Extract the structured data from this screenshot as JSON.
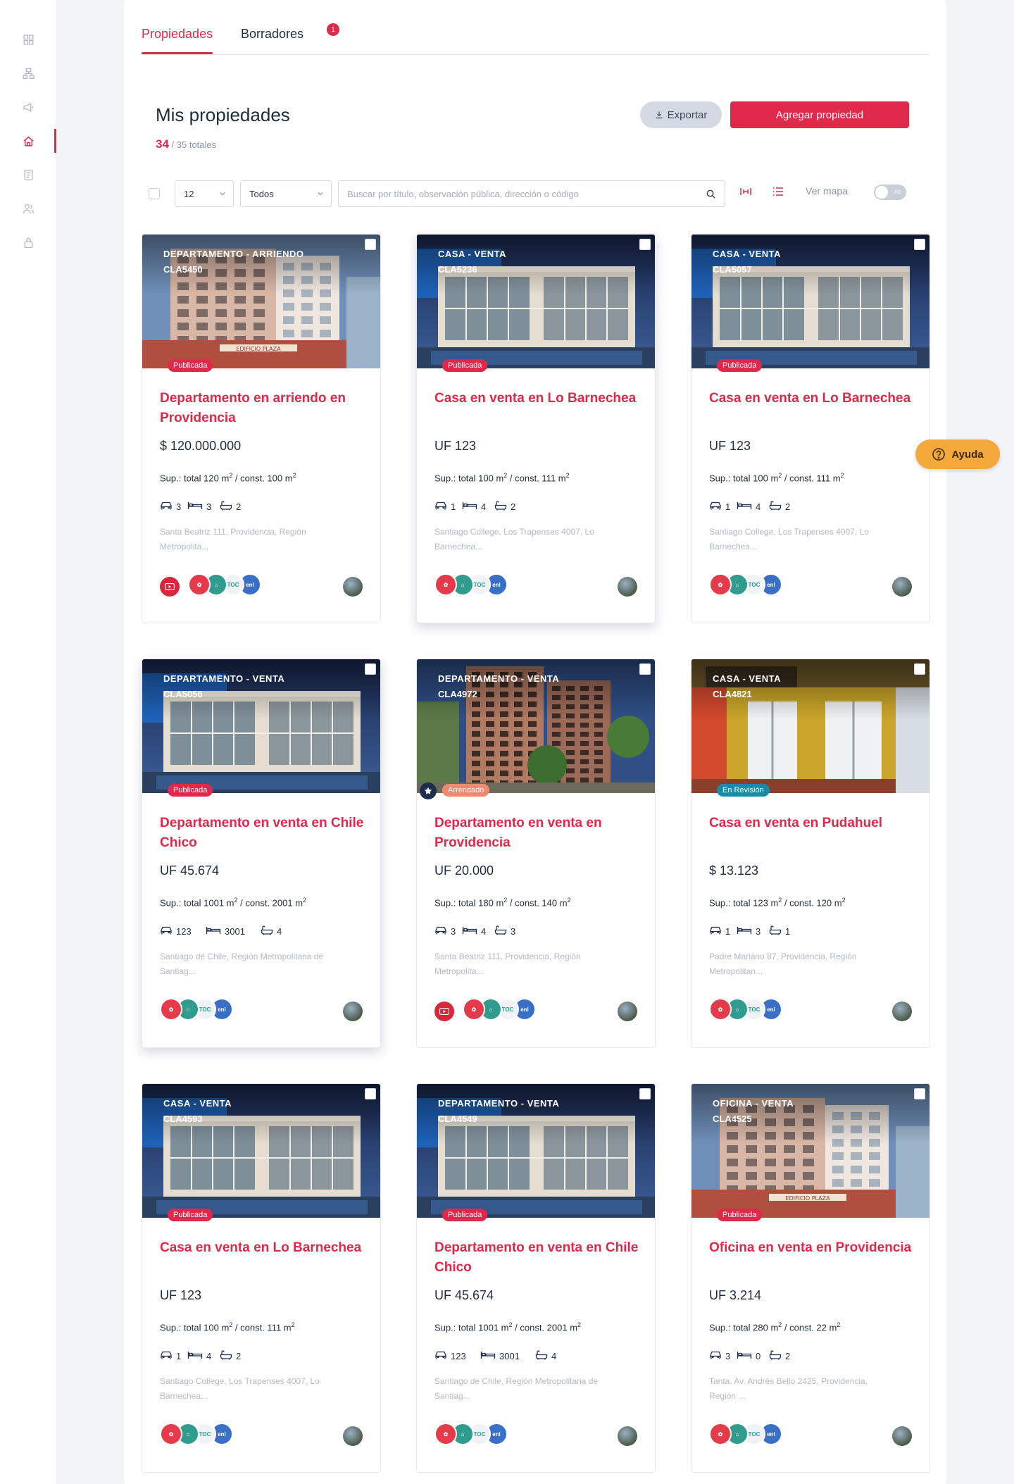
{
  "tabs": [
    {
      "label": "Propiedades",
      "active": true
    },
    {
      "label": "Borradores",
      "badge": "1"
    }
  ],
  "header": {
    "title": "Mis propiedades",
    "count": "34",
    "total": "/ 35 totales",
    "export_label": "Exportar",
    "add_label": "Agregar propiedad"
  },
  "filters": {
    "page_size": "12",
    "status": "Todos",
    "search_placeholder": "Buscar por título, observación pública, dirección o código",
    "map_label": "Ver mapa",
    "map_toggle": "no"
  },
  "help_label": "Ayuda",
  "colors": {
    "accent": "#e0294a",
    "published": "#e0294a",
    "rented": "#f08a6e",
    "review": "#1a8aa8"
  },
  "properties": [
    {
      "type": "DEPARTAMENTO - ARRIENDO",
      "code": "CLA5450",
      "status": "Publicada",
      "title": "Departamento en arriendo en Providencia",
      "price": "$ 120.000.000",
      "sup": "Sup.: total 120 m",
      "sup_mid": " / const. 100 m",
      "parking": "3",
      "beds": "3",
      "baths": "2",
      "address": "Santa Beatriz 111, Providencia, Región Metropolita...",
      "youtube": true,
      "image": "plaza"
    },
    {
      "type": "CASA - VENTA",
      "code": "CLA5236",
      "status": "Publicada",
      "title": "Casa en venta en Lo Barnechea",
      "price": "UF 123",
      "sup": "Sup.: total 100 m",
      "sup_mid": " / const. 111 m",
      "parking": "1",
      "beds": "4",
      "baths": "2",
      "address": "Santiago College, Los Trapenses 4007, Lo Barnechea...",
      "youtube": false,
      "image": "house"
    },
    {
      "type": "CASA - VENTA",
      "code": "CLA5057",
      "status": "Publicada",
      "title": "Casa en venta en Lo Barnechea",
      "price": "UF 123",
      "sup": "Sup.: total 100 m",
      "sup_mid": " / const. 111 m",
      "parking": "1",
      "beds": "4",
      "baths": "2",
      "address": "Santiago College, Los Trapenses 4007, Lo Barnechea...",
      "youtube": false,
      "image": "house"
    },
    {
      "type": "DEPARTAMENTO - VENTA",
      "code": "CLA5056",
      "status": "Publicada",
      "title": "Departamento en venta en Chile Chico",
      "price": "UF 45.674",
      "sup": "Sup.: total 1001 m",
      "sup_mid": " / const. 2001 m",
      "parking": "123",
      "beds": "3001",
      "baths": "4",
      "address": "Santiago de Chile, Región Metropolitana de Santiag...",
      "youtube": false,
      "image": "house"
    },
    {
      "type": "DEPARTAMENTO - VENTA",
      "code": "CLA4972",
      "status": "Arrendado",
      "title": "Departamento en venta en Providencia",
      "price": "UF 20.000",
      "sup": "Sup.: total 180 m",
      "sup_mid": " / const. 140 m",
      "parking": "3",
      "beds": "4",
      "baths": "3",
      "address": "Santa Beatriz 111, Providencia, Región Metropolita...",
      "youtube": true,
      "image": "tower",
      "featured": true
    },
    {
      "type": "CASA - VENTA",
      "code": "CLA4821",
      "status": "En Revisión",
      "title": "Casa en venta en Pudahuel",
      "price": "$ 13.123",
      "sup": "Sup.: total 123 m",
      "sup_mid": " / const. 120 m",
      "parking": "1",
      "beds": "3",
      "baths": "1",
      "address": "Padre Mariano 87, Providencia, Región Metropolitan...",
      "youtube": false,
      "image": "yellow"
    },
    {
      "type": "CASA - VENTA",
      "code": "CLA4593",
      "status": "Publicada",
      "title": "Casa en venta en Lo Barnechea",
      "price": "UF 123",
      "sup": "Sup.: total 100 m",
      "sup_mid": " / const. 111 m",
      "parking": "1",
      "beds": "4",
      "baths": "2",
      "address": "Santiago College, Los Trapenses 4007, Lo Barnechea...",
      "youtube": false,
      "image": "house"
    },
    {
      "type": "DEPARTAMENTO - VENTA",
      "code": "CLA4549",
      "status": "Publicada",
      "title": "Departamento en venta en Chile Chico",
      "price": "UF 45.674",
      "sup": "Sup.: total 1001 m",
      "sup_mid": " / const. 2001 m",
      "parking": "123",
      "beds": "3001",
      "baths": "4",
      "address": "Santiago de Chile, Región Metropolitana de Santiag...",
      "youtube": false,
      "image": "house"
    },
    {
      "type": "OFICINA - VENTA",
      "code": "CLA4525",
      "status": "Publicada",
      "title": "Oficina en venta en Providencia",
      "price": "UF 3.214",
      "sup": "Sup.: total 280 m",
      "sup_mid": " / const. 22 m",
      "parking": "3",
      "beds": "0",
      "baths": "2",
      "address": "Tanta, Av. Andrés Bello 2425, Providencia, Región ...",
      "youtube": false,
      "image": "plaza"
    }
  ],
  "sup_exp": "2"
}
